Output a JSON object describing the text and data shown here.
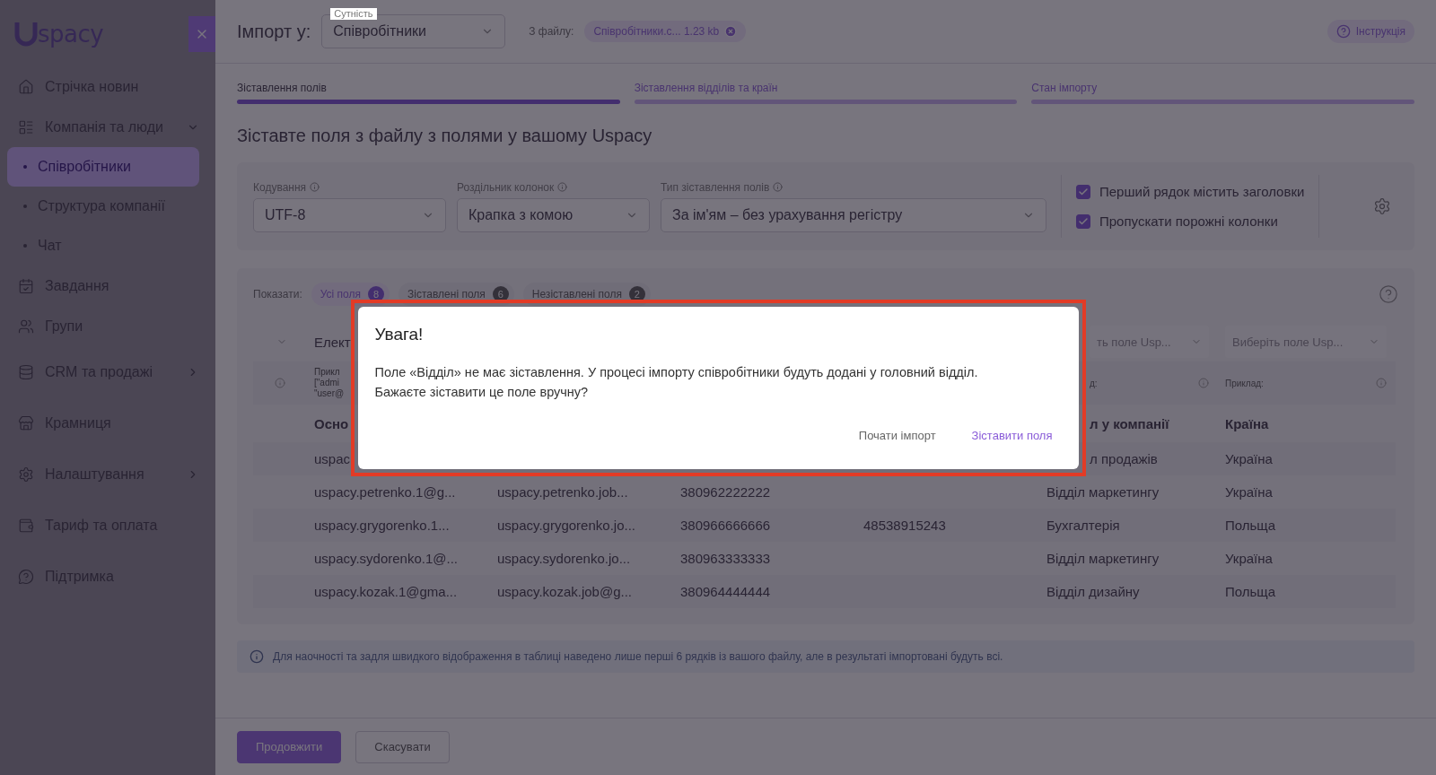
{
  "sidebar": {
    "logo": "spacy",
    "items": [
      {
        "label": "Стрічка новин"
      },
      {
        "label": "Компанія та люди",
        "expanded": true,
        "children": [
          {
            "label": "Співробітники",
            "selected": true
          },
          {
            "label": "Структура компанії",
            "selected": false
          },
          {
            "label": "Чат",
            "selected": false
          }
        ]
      },
      {
        "label": "Завдання"
      },
      {
        "label": "Групи"
      },
      {
        "label": "CRM та продажі",
        "expanded": false
      },
      {
        "label": "Крамниця"
      },
      {
        "label": "Налаштування",
        "expanded": false
      },
      {
        "label": "Тариф та оплата"
      },
      {
        "label": "Підтримка"
      }
    ]
  },
  "header": {
    "title": "Імпорт у:",
    "entity": {
      "label": "Сутність",
      "value": "Співробітники"
    },
    "file_label": "З файлу:",
    "file_chip": "Співробітники.c... 1.23 kb",
    "help": "Інструкція"
  },
  "steps": [
    {
      "label": "Зіставлення полів",
      "selected": true
    },
    {
      "label": "Зіставлення відділів та країн",
      "selected": false
    },
    {
      "label": "Стан імпорту",
      "selected": false
    }
  ],
  "heading": "Зіставте поля з файлу з полями у вашому Uspacy",
  "settings": {
    "selects": [
      {
        "label": "Кодування",
        "value": "UTF-8"
      },
      {
        "label": "Роздільник колонок",
        "value": "Крапка з комою"
      },
      {
        "label": "Тип зіставлення полів",
        "value": "За ім'ям – без урахування регістру"
      }
    ],
    "checkboxes": [
      {
        "label": "Перший рядок містить заголовки",
        "checked": true
      },
      {
        "label": "Пропускати порожні колонки",
        "checked": true
      }
    ]
  },
  "filters": {
    "label": "Показати:",
    "chips": [
      {
        "label": "Усі поля",
        "count": "8",
        "selected": true
      },
      {
        "label": "Зіставлені поля",
        "count": "6",
        "selected": false
      },
      {
        "label": "Незіставлені поля",
        "count": "2",
        "selected": false
      }
    ]
  },
  "table": {
    "mapping": {
      "column_1": {
        "kind": "caret"
      },
      "column_2": {
        "kind": "text",
        "text": "Елект"
      },
      "column_6": {
        "kind": "select",
        "text": "ть поле Usp...",
        "covered_start": true
      },
      "column_7": {
        "kind": "select",
        "text": "Виберіть поле Usp..."
      }
    },
    "examples": {
      "column_1": {
        "kind": "info"
      },
      "column_2": {
        "kind": "lines",
        "lines": [
          "Прикл",
          "[\"admi",
          "\"user@"
        ]
      },
      "column_6": {
        "kind": "label",
        "text": "д:",
        "covered_start": true
      },
      "column_7": {
        "kind": "label",
        "text": "Приклад:"
      }
    },
    "header": {
      "column_2": {
        "kind": "text",
        "text": "Осно"
      },
      "column_6": {
        "kind": "text",
        "text": "л у компанії",
        "covered_start": true
      },
      "column_7": {
        "kind": "text",
        "text": "Країна"
      }
    },
    "rows": [
      [
        "",
        "uspac",
        "",
        "",
        "",
        {
          "kind": "text",
          "text": "л продажів",
          "covered_start": true
        },
        "Україна"
      ],
      [
        "",
        "uspacy.petrenko.1@g...",
        "uspacy.petrenko.job...",
        "380962222222",
        "",
        "Відділ маркетингу",
        "Україна"
      ],
      [
        "",
        "uspacy.grygorenko.1...",
        "uspacy.grygorenko.jo...",
        "380966666666",
        "48538915243",
        "Бухгалтерія",
        "Польща"
      ],
      [
        "",
        "uspacy.sydorenko.1@...",
        "uspacy.sydorenko.jo...",
        "380963333333",
        "",
        "Відділ маркетингу",
        "Україна"
      ],
      [
        "",
        "uspacy.kozak.1@gma...",
        "uspacy.kozak.job@g...",
        "380964444444",
        "",
        "Відділ дизайну",
        "Польща"
      ]
    ]
  },
  "note": "Для наочності та задля швидкого відображення в таблиці наведено лише перші 6 рядків із вашого файлу, але в результаті імпортовані будуть всі.",
  "footer": {
    "buttons": [
      {
        "label": "Продовжити",
        "kind": "primary"
      },
      {
        "label": "Скасувати",
        "kind": "secondary"
      }
    ]
  },
  "modal": {
    "title": "Увага!",
    "lines": [
      "Поле «Відділ» не має зіставлення. У процесі імпорту співробітники будуть додані у головний відділ.",
      "Бажаєте зіставити це поле вручну?"
    ],
    "actions": [
      {
        "label": "Почати імпорт",
        "kind": "secondary"
      },
      {
        "label": "Зіставити поля",
        "kind": "primary"
      }
    ]
  }
}
